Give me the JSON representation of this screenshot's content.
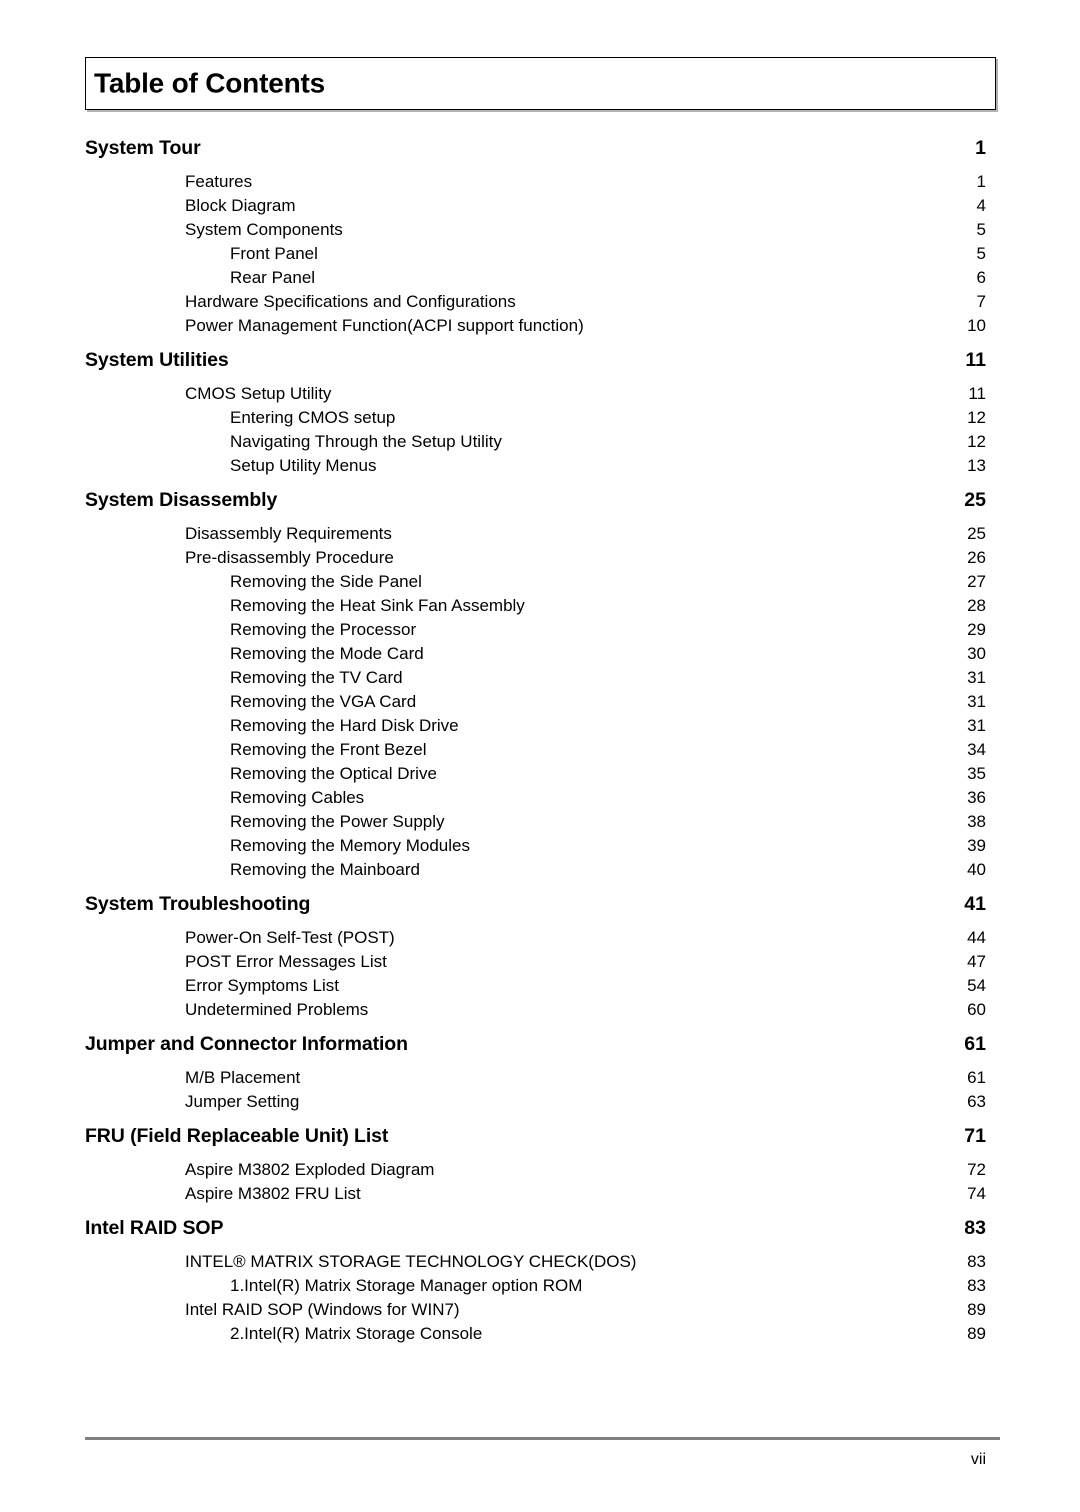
{
  "document": {
    "title": "Table of Contents",
    "footer_page_label": "vii"
  },
  "toc": {
    "sections": [
      {
        "title": "System Tour",
        "page": "1",
        "entries": [
          {
            "level": 1,
            "label": "Features",
            "page": "1"
          },
          {
            "level": 1,
            "label": "Block Diagram",
            "page": "4"
          },
          {
            "level": 1,
            "label": "System Components",
            "page": "5"
          },
          {
            "level": 2,
            "label": "Front Panel",
            "page": "5"
          },
          {
            "level": 2,
            "label": "Rear Panel",
            "page": "6"
          },
          {
            "level": 1,
            "label": "Hardware Specifications and Configurations",
            "page": "7"
          },
          {
            "level": 1,
            "label": "Power Management Function(ACPI support function)",
            "page": "10"
          }
        ]
      },
      {
        "title": "System Utilities",
        "page": "11",
        "entries": [
          {
            "level": 1,
            "label": "CMOS Setup Utility",
            "page": "11"
          },
          {
            "level": 2,
            "label": "Entering CMOS setup",
            "page": "12"
          },
          {
            "level": 2,
            "label": "Navigating Through the Setup Utility",
            "page": "12"
          },
          {
            "level": 2,
            "label": "Setup Utility Menus",
            "page": "13"
          }
        ]
      },
      {
        "title": "System Disassembly",
        "page": "25",
        "entries": [
          {
            "level": 1,
            "label": "Disassembly Requirements",
            "page": "25"
          },
          {
            "level": 1,
            "label": "Pre-disassembly Procedure",
            "page": "26"
          },
          {
            "level": 2,
            "label": "Removing the Side Panel",
            "page": "27"
          },
          {
            "level": 2,
            "label": "Removing the Heat Sink Fan Assembly",
            "page": "28"
          },
          {
            "level": 2,
            "label": "Removing the Processor",
            "page": "29"
          },
          {
            "level": 2,
            "label": "Removing the Mode Card",
            "page": "30"
          },
          {
            "level": 2,
            "label": "Removing the TV Card",
            "page": "31"
          },
          {
            "level": 2,
            "label": "Removing the VGA Card",
            "page": "31"
          },
          {
            "level": 2,
            "label": "Removing the Hard Disk Drive",
            "page": "31"
          },
          {
            "level": 2,
            "label": "Removing the Front Bezel",
            "page": "34"
          },
          {
            "level": 2,
            "label": "Removing the Optical Drive",
            "page": "35"
          },
          {
            "level": 2,
            "label": "Removing Cables",
            "page": "36"
          },
          {
            "level": 2,
            "label": "Removing the Power Supply",
            "page": "38"
          },
          {
            "level": 2,
            "label": "Removing the Memory Modules",
            "page": "39"
          },
          {
            "level": 2,
            "label": "Removing the Mainboard",
            "page": "40"
          }
        ]
      },
      {
        "title": "System Troubleshooting",
        "page": "41",
        "entries": [
          {
            "level": 1,
            "label": "Power-On Self-Test (POST)",
            "page": "44"
          },
          {
            "level": 1,
            "label": "POST Error Messages List",
            "page": "47"
          },
          {
            "level": 1,
            "label": "Error Symptoms List",
            "page": "54"
          },
          {
            "level": 1,
            "label": "Undetermined Problems",
            "page": "60"
          }
        ]
      },
      {
        "title": "Jumper and Connector Information",
        "page": "61",
        "entries": [
          {
            "level": 1,
            "label": "M/B Placement",
            "page": "61"
          },
          {
            "level": 1,
            "label": "Jumper Setting",
            "page": "63"
          }
        ]
      },
      {
        "title": "FRU (Field Replaceable Unit) List",
        "page": "71",
        "entries": [
          {
            "level": 1,
            "label": "Aspire M3802 Exploded Diagram",
            "page": "72"
          },
          {
            "level": 1,
            "label": "Aspire M3802 FRU List",
            "page": "74"
          }
        ]
      },
      {
        "title": "Intel RAID SOP",
        "page": "83",
        "entries": [
          {
            "level": 1,
            "label": "INTEL® MATRIX STORAGE TECHNOLOGY CHECK(DOS)",
            "page": "83"
          },
          {
            "level": 2,
            "label": "1.Intel(R) Matrix Storage Manager option ROM",
            "page": "83"
          },
          {
            "level": 1,
            "label": "Intel RAID SOP (Windows for WIN7)",
            "page": "89"
          },
          {
            "level": 2,
            "label": "2.Intel(R) Matrix Storage Console",
            "page": "89"
          }
        ]
      }
    ]
  }
}
